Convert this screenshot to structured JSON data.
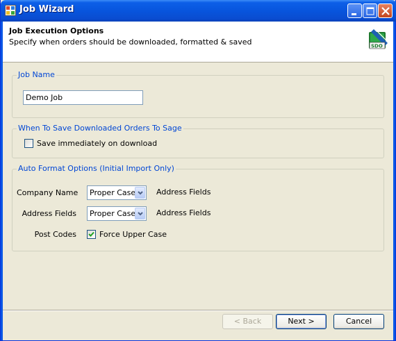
{
  "window": {
    "title": "Job Wizard",
    "accent_color": "#0855dd"
  },
  "header": {
    "title": "Job Execution Options",
    "subtitle": "Specify when orders should be downloaded, formatted & saved",
    "logo_icon": "sage-database-icon"
  },
  "job_name_group": {
    "legend": "Job Name",
    "value": "Demo Job"
  },
  "save_group": {
    "legend": "When To Save Downloaded Orders To Sage",
    "checkbox_label": "Save immediately on download",
    "checked": false
  },
  "format_group": {
    "legend": "Auto Format Options (Initial Import Only)",
    "company_name_label": "Company Name",
    "company_name_value": "Proper Case",
    "company_name_note": "Address Fields",
    "address_fields_label": "Address Fields",
    "address_fields_value": "Proper Case",
    "address_fields_note": "Address Fields",
    "post_codes_label": "Post Codes",
    "post_codes_checkbox_label": "Force Upper Case",
    "post_codes_checked": true
  },
  "footer": {
    "back_label": "< Back",
    "next_label": "Next >",
    "cancel_label": "Cancel"
  }
}
